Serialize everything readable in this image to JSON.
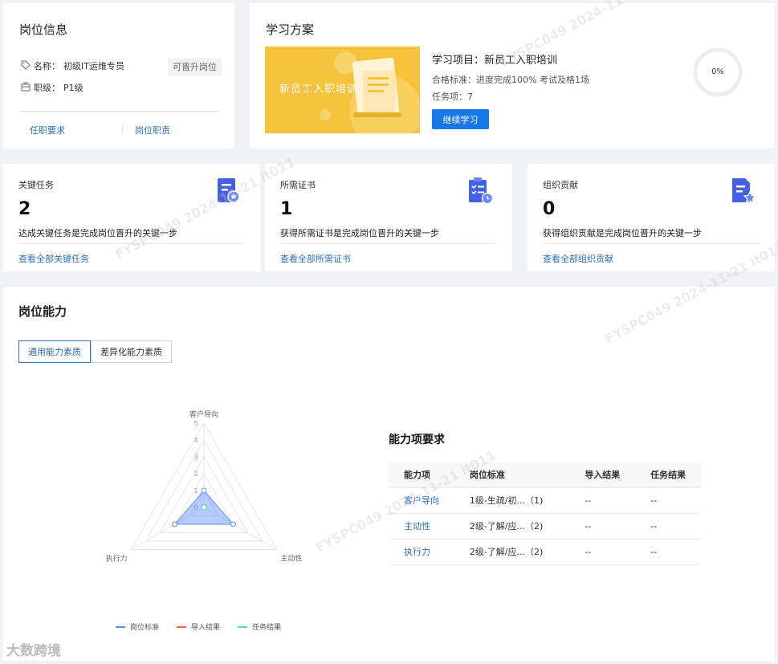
{
  "position": {
    "title": "岗位信息",
    "name_label": "名称：",
    "name_value": "初级IT运维专员",
    "promote_tag": "可晋升岗位",
    "level_label": "职级：",
    "level_value": "P1级",
    "requirement_link": "任职要求",
    "duty_link": "岗位职责"
  },
  "learning": {
    "title": "学习方案",
    "banner_text": "新员工入职培训",
    "project_label": "学习项目：",
    "project_name": "新员工入职培训",
    "pass_label": "合格标准：",
    "pass_value": "进度完成100% 考试及格1场",
    "task_label": "任务项：",
    "task_count": "7",
    "continue_button": "继续学习",
    "progress_text": "0%",
    "progress_value": 0
  },
  "stats": [
    {
      "label": "关键任务",
      "value": "2",
      "desc": "达成关键任务是完成岗位晋升的关键一步",
      "link": "查看全部关键任务",
      "icon": "certificate-icon"
    },
    {
      "label": "所需证书",
      "value": "1",
      "desc": "获得所需证书是完成岗位晋升的关键一步",
      "link": "查看全部所需证书",
      "icon": "checklist-icon"
    },
    {
      "label": "组织贡献",
      "value": "0",
      "desc": "获得组织贡献是完成岗位晋升的关键一步",
      "link": "查看全部组织贡献",
      "icon": "document-star-icon"
    }
  ],
  "ability": {
    "title": "岗位能力",
    "tabs": [
      "通用能力素质",
      "差异化能力素质"
    ],
    "active_tab": 0,
    "legend": [
      "岗位标准",
      "导入结果",
      "任务结果"
    ],
    "requirements_title": "能力项要求",
    "table_headers": [
      "能力项",
      "岗位标准",
      "导入结果",
      "任务结果"
    ],
    "rows": [
      {
        "name": "客户导向",
        "standard": "1级-生疏/初...（1)",
        "import": "--",
        "task": "--"
      },
      {
        "name": "主动性",
        "standard": "2级-了解/应...（2)",
        "import": "--",
        "task": "--"
      },
      {
        "name": "执行力",
        "standard": "2级-了解/应...（2)",
        "import": "--",
        "task": "--"
      }
    ]
  },
  "colors": {
    "accent": "#1677e8",
    "link": "#2c6fb5",
    "banner": "#f4c23b",
    "series_standard": "#5b8ff9",
    "series_import": "#e8684a",
    "series_task": "#5ad8a6"
  },
  "chart_data": {
    "type": "radar",
    "axes": [
      "客户导向",
      "主动性",
      "执行力"
    ],
    "range": [
      0,
      5
    ],
    "tick_labels": [
      "0",
      "1",
      "2",
      "3",
      "4",
      "5"
    ],
    "series": [
      {
        "name": "岗位标准",
        "values": [
          1,
          2,
          2
        ]
      },
      {
        "name": "导入结果",
        "values": [
          0,
          0,
          0
        ]
      },
      {
        "name": "任务结果",
        "values": [
          0,
          0,
          0
        ]
      }
    ],
    "legend_position": "bottom"
  },
  "watermarks": [
    "FYSPC049 2024-11-21 it011"
  ],
  "corner_logo": "大数跨境"
}
